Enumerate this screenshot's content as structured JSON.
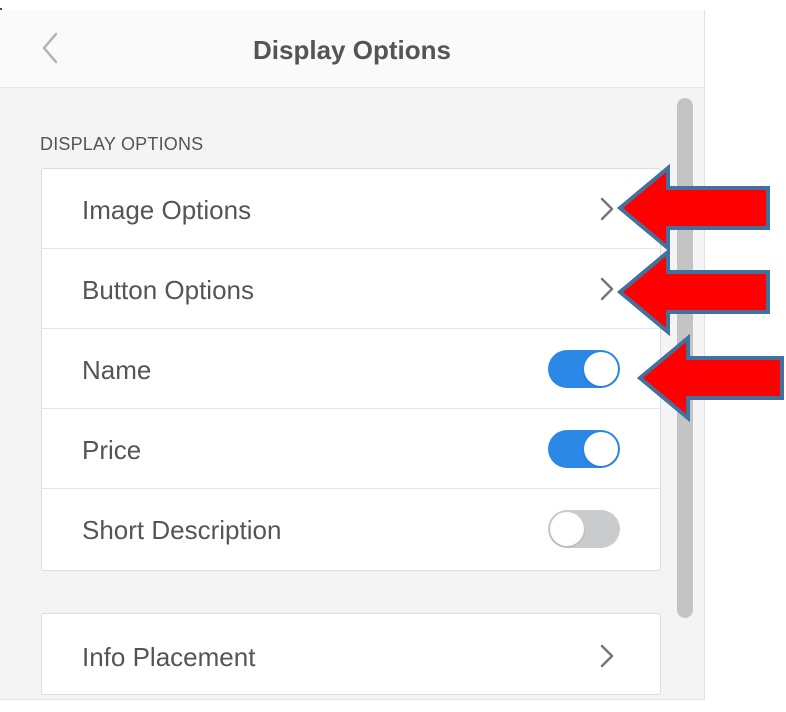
{
  "header": {
    "title": "Display Options",
    "back_icon": "chevron-left-icon"
  },
  "section": {
    "label": "DISPLAY OPTIONS",
    "items": [
      {
        "label": "Image Options",
        "control": "chevron",
        "icon": "chevron-right-icon"
      },
      {
        "label": "Button Options",
        "control": "chevron",
        "icon": "chevron-right-icon"
      },
      {
        "label": "Name",
        "control": "toggle",
        "enabled": true
      },
      {
        "label": "Price",
        "control": "toggle",
        "enabled": true
      },
      {
        "label": "Short Description",
        "control": "toggle",
        "enabled": false
      }
    ]
  },
  "info_placement": {
    "label": "Info Placement",
    "icon": "chevron-right-icon"
  },
  "annotations": {
    "arrow_color": "#ff0000",
    "arrow_outline": "#41719c",
    "arrows": [
      "Image Options",
      "Button Options",
      "Name"
    ]
  },
  "colors": {
    "toggle_on": "#2b88e6",
    "toggle_off": "#c9cbcd",
    "text": "#555555",
    "panel_bg": "#f4f4f4"
  }
}
